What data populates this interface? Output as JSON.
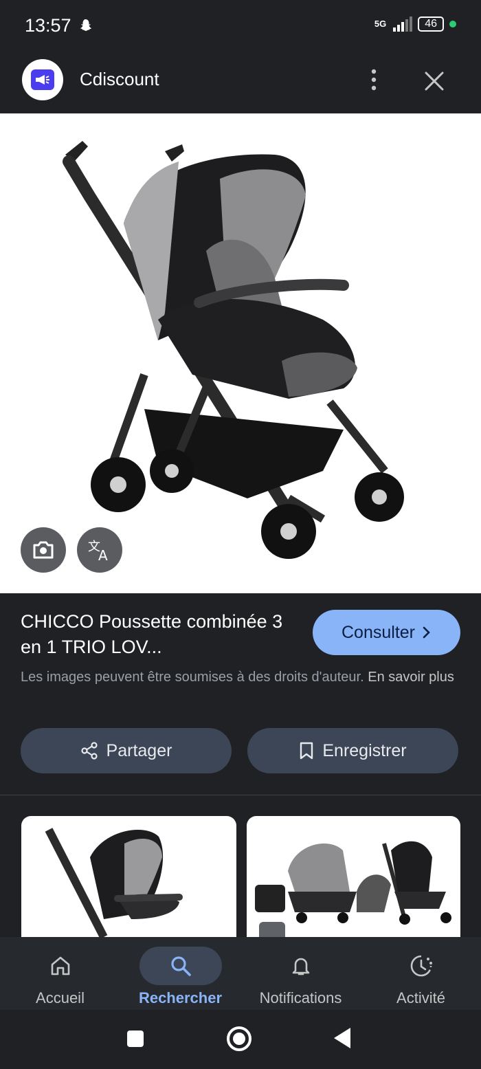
{
  "status": {
    "time": "13:57",
    "network": "5G",
    "battery": "46"
  },
  "appbar": {
    "title": "Cdiscount"
  },
  "result": {
    "title": "CHICCO Poussette combinée 3 en 1 TRIO LOV...",
    "consult_label": "Consulter",
    "copyright_text": "Les images peuvent être soumises à des droits d'auteur.",
    "learn_more": "En savoir plus",
    "share_label": "Partager",
    "save_label": "Enregistrer"
  },
  "bottom_nav": {
    "items": [
      {
        "label": "Accueil",
        "icon": "home-icon"
      },
      {
        "label": "Rechercher",
        "icon": "search-icon",
        "active": true
      },
      {
        "label": "Notifications",
        "icon": "bell-icon"
      },
      {
        "label": "Activité",
        "icon": "activity-icon"
      }
    ]
  },
  "colors": {
    "accent": "#8ab4f8",
    "background": "#1f2125",
    "chip": "#3c4656"
  }
}
